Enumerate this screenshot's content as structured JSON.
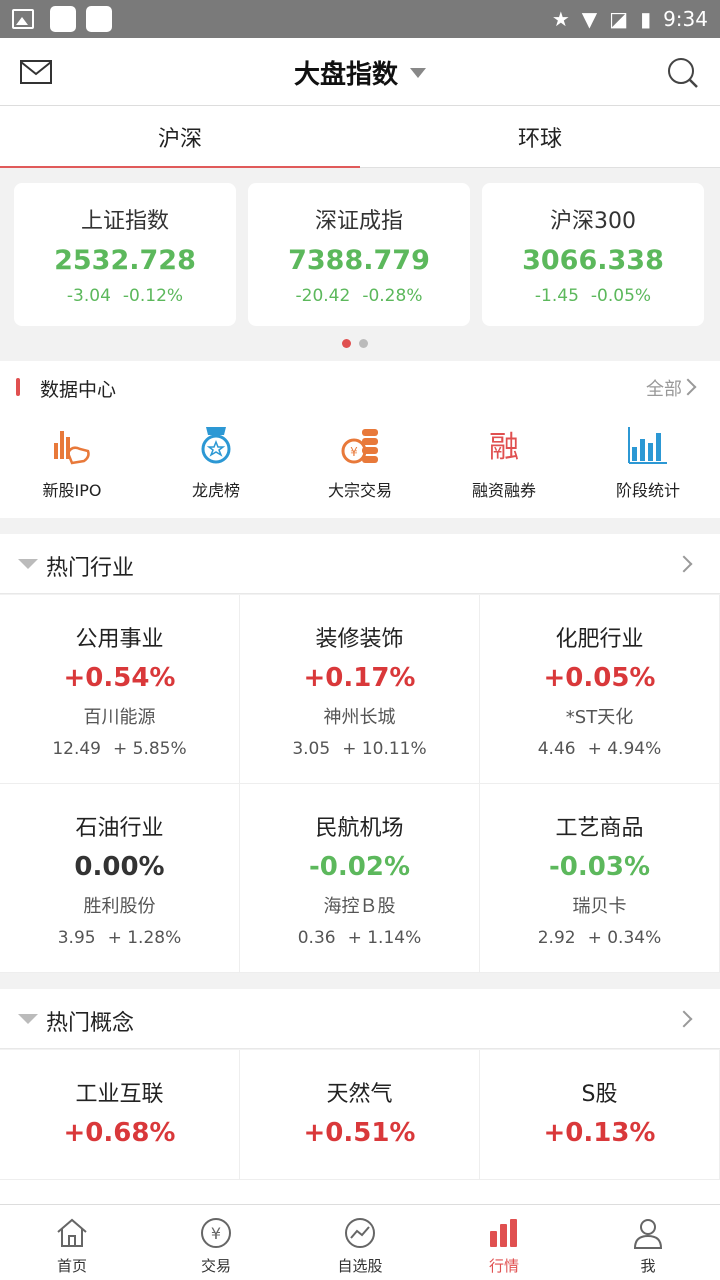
{
  "status_bar": {
    "time": "9:34"
  },
  "header": {
    "title": "大盘指数"
  },
  "tabs": [
    {
      "label": "沪深",
      "active": true
    },
    {
      "label": "环球",
      "active": false
    }
  ],
  "indices": [
    {
      "name": "上证指数",
      "value": "2532.728",
      "change": "-3.04",
      "pct": "-0.12%"
    },
    {
      "name": "深证成指",
      "value": "7388.779",
      "change": "-20.42",
      "pct": "-0.28%"
    },
    {
      "name": "沪深300",
      "value": "3066.338",
      "change": "-1.45",
      "pct": "-0.05%"
    }
  ],
  "data_center": {
    "title": "数据中心",
    "all_label": "全部",
    "items": [
      {
        "label": "新股IPO",
        "icon": "ipo-hand-icon"
      },
      {
        "label": "龙虎榜",
        "icon": "medal-icon"
      },
      {
        "label": "大宗交易",
        "icon": "coins-icon"
      },
      {
        "label": "融资融券",
        "icon": "margin-icon"
      },
      {
        "label": "阶段统计",
        "icon": "bar-stats-icon"
      }
    ]
  },
  "hot_industry": {
    "title": "热门行业",
    "items": [
      {
        "name": "公用事业",
        "pct": "+0.54%",
        "trend": "up",
        "stock": "百川能源",
        "price": "12.49",
        "stock_pct": "+ 5.85%"
      },
      {
        "name": "装修装饰",
        "pct": "+0.17%",
        "trend": "up",
        "stock": "神州长城",
        "price": "3.05",
        "stock_pct": "+ 10.11%"
      },
      {
        "name": "化肥行业",
        "pct": "+0.05%",
        "trend": "up",
        "stock": "*ST天化",
        "price": "4.46",
        "stock_pct": "+ 4.94%"
      },
      {
        "name": "石油行业",
        "pct": "0.00%",
        "trend": "flat",
        "stock": "胜利股份",
        "price": "3.95",
        "stock_pct": "+ 1.28%"
      },
      {
        "name": "民航机场",
        "pct": "-0.02%",
        "trend": "down",
        "stock": "海控Ｂ股",
        "price": "0.36",
        "stock_pct": "+ 1.14%"
      },
      {
        "name": "工艺商品",
        "pct": "-0.03%",
        "trend": "down",
        "stock": "瑞贝卡",
        "price": "2.92",
        "stock_pct": "+ 0.34%"
      }
    ]
  },
  "hot_concept": {
    "title": "热门概念",
    "items": [
      {
        "name": "工业互联",
        "pct": "+0.68%",
        "trend": "up"
      },
      {
        "name": "天然气",
        "pct": "+0.51%",
        "trend": "up"
      },
      {
        "name": "S股",
        "pct": "+0.13%",
        "trend": "up"
      }
    ]
  },
  "bottom_nav": [
    {
      "label": "首页",
      "icon": "home-icon",
      "active": false
    },
    {
      "label": "交易",
      "icon": "yen-icon",
      "active": false
    },
    {
      "label": "自选股",
      "icon": "trend-circle-icon",
      "active": false
    },
    {
      "label": "行情",
      "icon": "bar-chart-icon",
      "active": true
    },
    {
      "label": "我",
      "icon": "person-icon",
      "active": false
    }
  ],
  "colors": {
    "up": "#d9383a",
    "down": "#5cb85c",
    "accent": "#e05050"
  }
}
